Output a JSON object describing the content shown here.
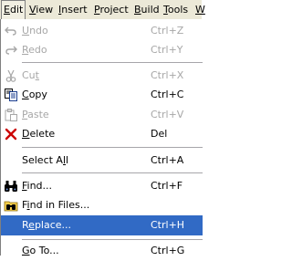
{
  "menubar": {
    "items": [
      {
        "pre": "",
        "key": "E",
        "post": "dit"
      },
      {
        "pre": "",
        "key": "V",
        "post": "iew"
      },
      {
        "pre": "",
        "key": "I",
        "post": "nsert"
      },
      {
        "pre": "",
        "key": "P",
        "post": "roject"
      },
      {
        "pre": "",
        "key": "B",
        "post": "uild"
      },
      {
        "pre": "",
        "key": "T",
        "post": "ools"
      },
      {
        "pre": "",
        "key": "W",
        "post": ""
      }
    ]
  },
  "edit_menu": {
    "items": [
      {
        "pre": "",
        "key": "U",
        "post": "ndo",
        "accel": "Ctrl+Z",
        "icon": "undo-icon"
      },
      {
        "pre": "",
        "key": "R",
        "post": "edo",
        "accel": "Ctrl+Y",
        "icon": "redo-icon"
      },
      {
        "pre": "Cu",
        "key": "t",
        "post": "",
        "accel": "Ctrl+X",
        "icon": "cut-icon"
      },
      {
        "pre": "",
        "key": "C",
        "post": "opy",
        "accel": "Ctrl+C",
        "icon": "copy-icon"
      },
      {
        "pre": "",
        "key": "P",
        "post": "aste",
        "accel": "Ctrl+V",
        "icon": "paste-icon"
      },
      {
        "pre": "",
        "key": "D",
        "post": "elete",
        "accel": "Del",
        "icon": "delete-icon"
      },
      {
        "pre": "Select A",
        "key": "l",
        "post": "l",
        "accel": "Ctrl+A"
      },
      {
        "pre": "",
        "key": "F",
        "post": "ind...",
        "accel": "Ctrl+F",
        "icon": "binoculars-icon"
      },
      {
        "pre": "F",
        "key": "i",
        "post": "nd in Files...",
        "accel": "",
        "icon": "find-in-files-icon"
      },
      {
        "pre": "R",
        "key": "e",
        "post": "place...",
        "accel": "Ctrl+H"
      },
      {
        "pre": "",
        "key": "G",
        "post": "o To...",
        "accel": "Ctrl+G"
      }
    ]
  }
}
